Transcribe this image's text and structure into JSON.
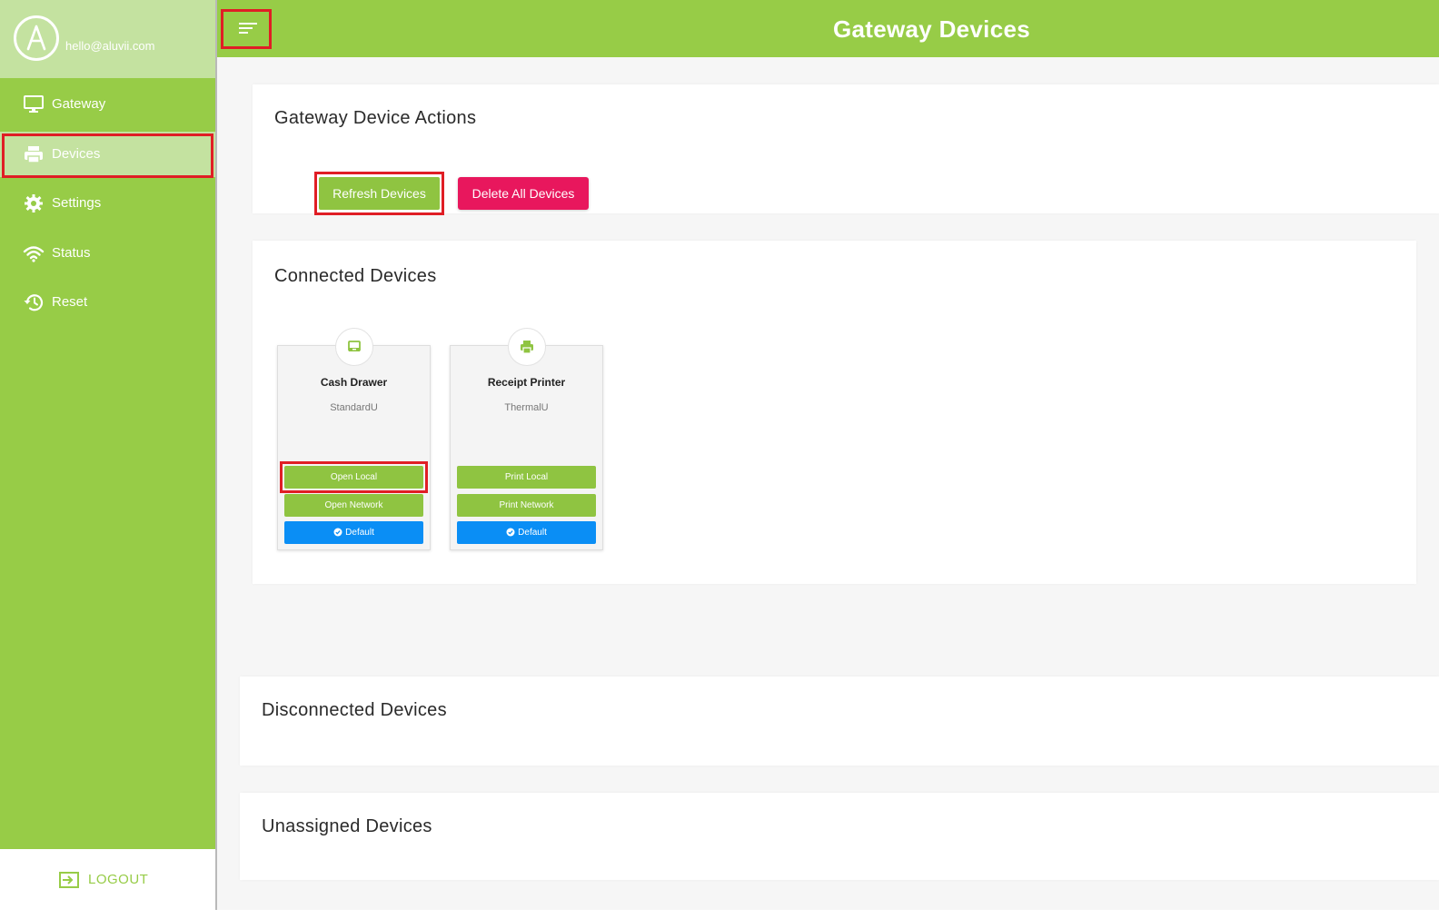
{
  "sidebar": {
    "logo_letter": "A",
    "user_email": "hello@aluvii.com",
    "items": [
      {
        "label": "Gateway",
        "icon": "monitor-icon"
      },
      {
        "label": "Devices",
        "icon": "printer-icon"
      },
      {
        "label": "Settings",
        "icon": "gear-icon"
      },
      {
        "label": "Status",
        "icon": "wifi-icon"
      },
      {
        "label": "Reset",
        "icon": "reset-icon"
      }
    ],
    "active_item": "Devices",
    "logout_label": "LOGOUT"
  },
  "header": {
    "title": "Gateway Devices",
    "menu_icon": "menu-icon"
  },
  "actions": {
    "title": "Gateway Device Actions",
    "refresh_label": "Refresh Devices",
    "delete_label": "Delete All Devices"
  },
  "connected": {
    "title": "Connected Devices",
    "devices": [
      {
        "name": "Cash Drawer",
        "model": "StandardU",
        "icon": "cash-drawer-icon",
        "local_label": "Open Local",
        "network_label": "Open Network",
        "default_label": "Default"
      },
      {
        "name": "Receipt Printer",
        "model": "ThermalU",
        "icon": "printer-icon",
        "local_label": "Print Local",
        "network_label": "Print Network",
        "default_label": "Default"
      }
    ]
  },
  "disconnected": {
    "title": "Disconnected Devices"
  },
  "unassigned": {
    "title": "Unassigned Devices"
  },
  "colors": {
    "brand_green": "#97cc47",
    "active_green": "#c4e2a0",
    "delete_pink": "#e8175d",
    "default_blue": "#0a8ef5",
    "highlight_red": "#e01e25"
  }
}
